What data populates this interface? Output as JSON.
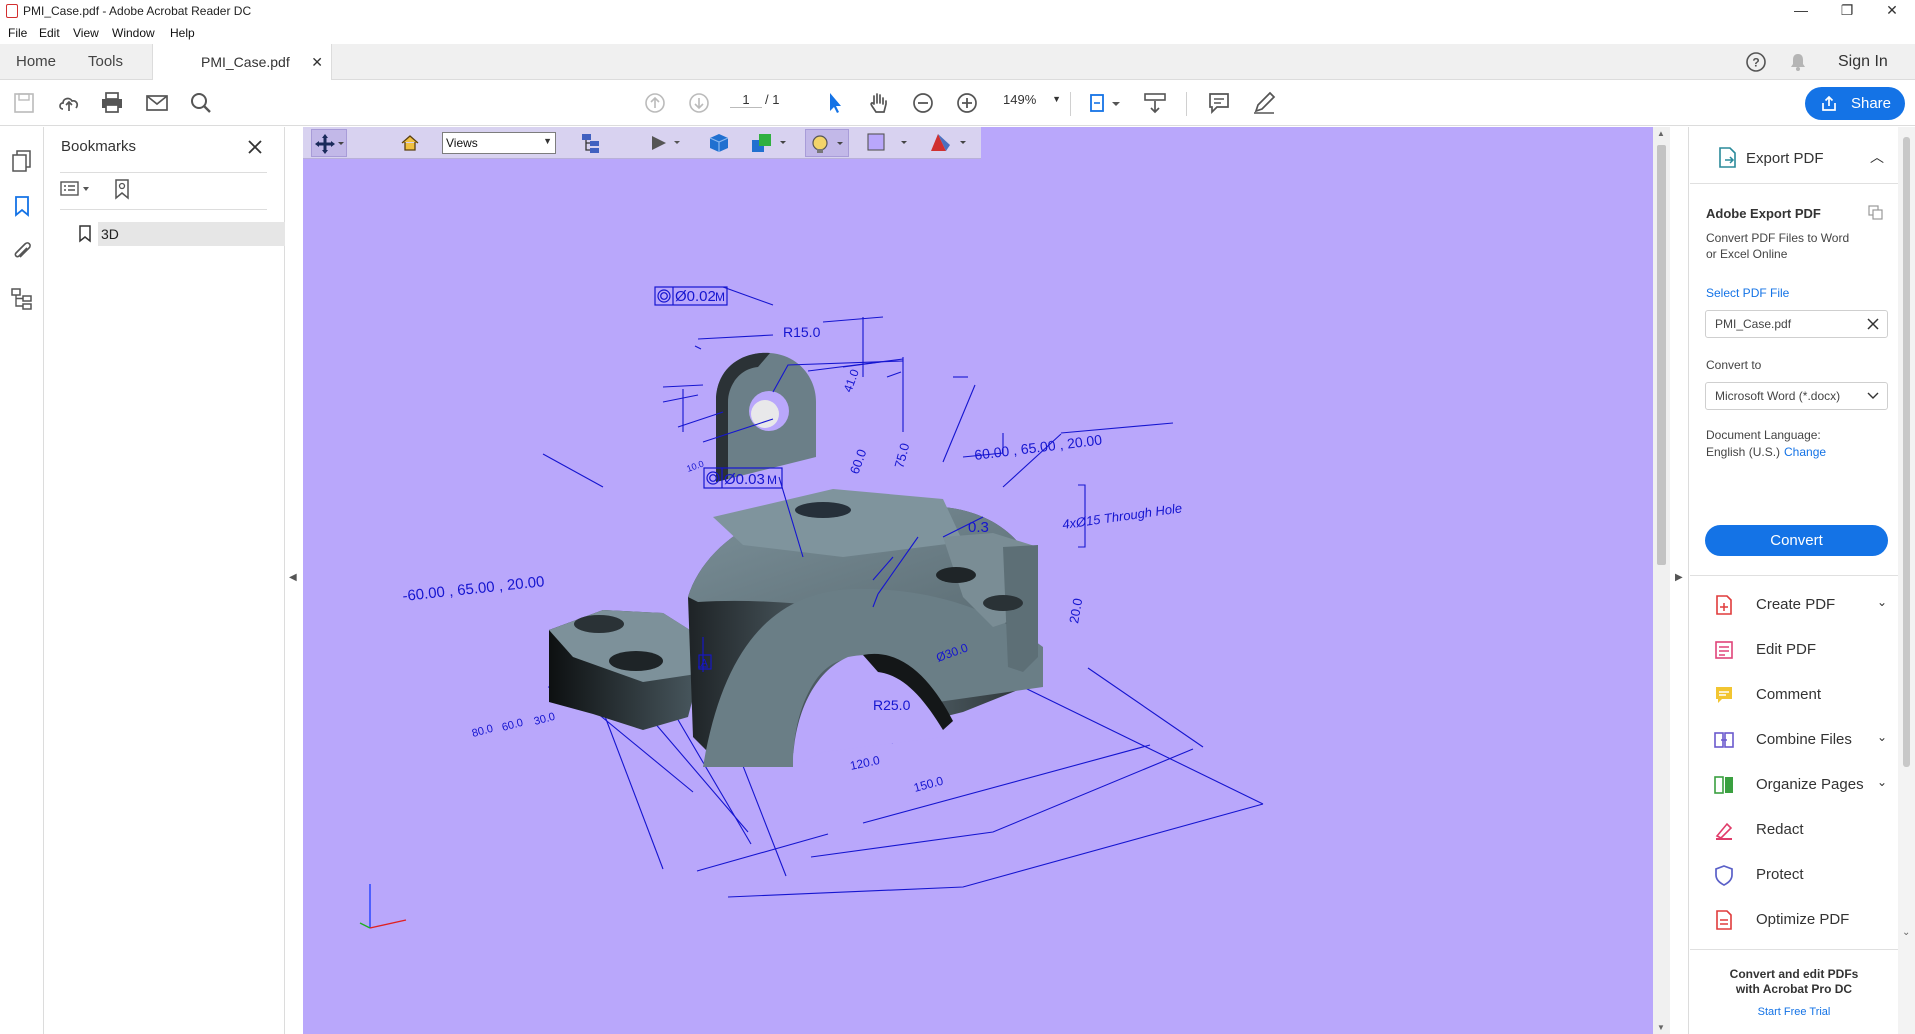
{
  "window": {
    "title": "PMI_Case.pdf - Adobe Acrobat Reader DC",
    "minimize": "—",
    "restore": "❐",
    "close": "✕"
  },
  "menu": [
    "File",
    "Edit",
    "View",
    "Window",
    "Help"
  ],
  "tabs": {
    "home": "Home",
    "tools": "Tools",
    "document": "PMI_Case.pdf",
    "close": "✕",
    "sign_in": "Sign In"
  },
  "toolbar": {
    "page_current": "1",
    "page_total": "/ 1",
    "zoom": "149%",
    "share_label": "Share"
  },
  "bookmarks": {
    "title": "Bookmarks",
    "items": [
      {
        "label": "3D"
      }
    ]
  },
  "toolbar_3d": {
    "views_select": "Views"
  },
  "pmi": {
    "r15": "R15.0",
    "fcf1": "Ø0.02",
    "fcf2": "Ø0.03",
    "m": "M",
    "coord_left": "-60.00 , 65.00 , 20.00",
    "coord_right": "60.00 , 65.00 , 20.00",
    "d41": "41.0",
    "d60": "60.0",
    "d75": "75.0",
    "d03": "0.3",
    "holes": "4xØ15 Through Hole",
    "d20": "20.0",
    "r25": "R25.0",
    "d120": "120.0",
    "d150": "150.0",
    "d800": "80.0",
    "d600": "60.0",
    "d300": "30.0",
    "datum_a": "A",
    "d100": "10.0",
    "d_small": "Ø30.0"
  },
  "right_pane": {
    "export_title": "Export PDF",
    "adobe_export": "Adobe Export PDF",
    "desc_line1": "Convert PDF Files to Word",
    "desc_line2": "or Excel Online",
    "select_file": "Select PDF File",
    "file_name": "PMI_Case.pdf",
    "convert_to": "Convert to",
    "format": "Microsoft Word (*.docx)",
    "doc_lang_label": "Document Language:",
    "doc_lang_value": "English (U.S.)",
    "change": "Change",
    "convert_button": "Convert",
    "tools": [
      {
        "label": "Create PDF",
        "chevron": "⌄"
      },
      {
        "label": "Edit PDF",
        "chevron": ""
      },
      {
        "label": "Comment",
        "chevron": ""
      },
      {
        "label": "Combine Files",
        "chevron": "⌄"
      },
      {
        "label": "Organize Pages",
        "chevron": "⌄"
      },
      {
        "label": "Redact",
        "chevron": ""
      },
      {
        "label": "Protect",
        "chevron": ""
      },
      {
        "label": "Optimize PDF",
        "chevron": ""
      }
    ],
    "promo_line1": "Convert and edit PDFs",
    "promo_line2": "with Acrobat Pro DC",
    "trial": "Start Free Trial"
  },
  "colors": {
    "accent": "#1473e6",
    "viewport": "#b9a7fb",
    "pmi": "#1515d0",
    "model": "#6d8088"
  }
}
